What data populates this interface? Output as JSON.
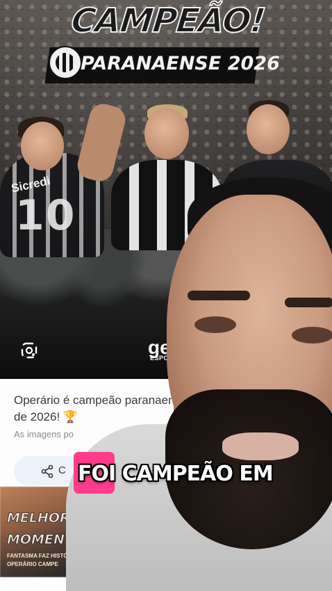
{
  "header_graphic": {
    "title": "CAMPEÃO!",
    "subtitle": "PARANAENSE 2026"
  },
  "photo": {
    "jersey_sponsor": "Sicredi",
    "jersey_number": "10",
    "watermark_brand": "ge",
    "watermark_sub": "ESPORTE"
  },
  "result_card": {
    "title": "Operário é campeão paranaense de 2026!",
    "title_emoji": "🏆",
    "caption": "As imagens po",
    "share_label": "C"
  },
  "thumbnail": {
    "title_line1": "MELHORES",
    "title_line2": "MOMENTOS",
    "small_line1": "FANTASMA FAZ HISTÓ",
    "small_line2": "OPERÁRIO CAMPE"
  },
  "video_caption": {
    "text": "FOI CAMPEÃO EM",
    "highlight_color": "#ff3d8b"
  },
  "icons": {
    "lens": "google-lens-icon",
    "share": "share-icon",
    "badge": "club-badge-icon"
  }
}
